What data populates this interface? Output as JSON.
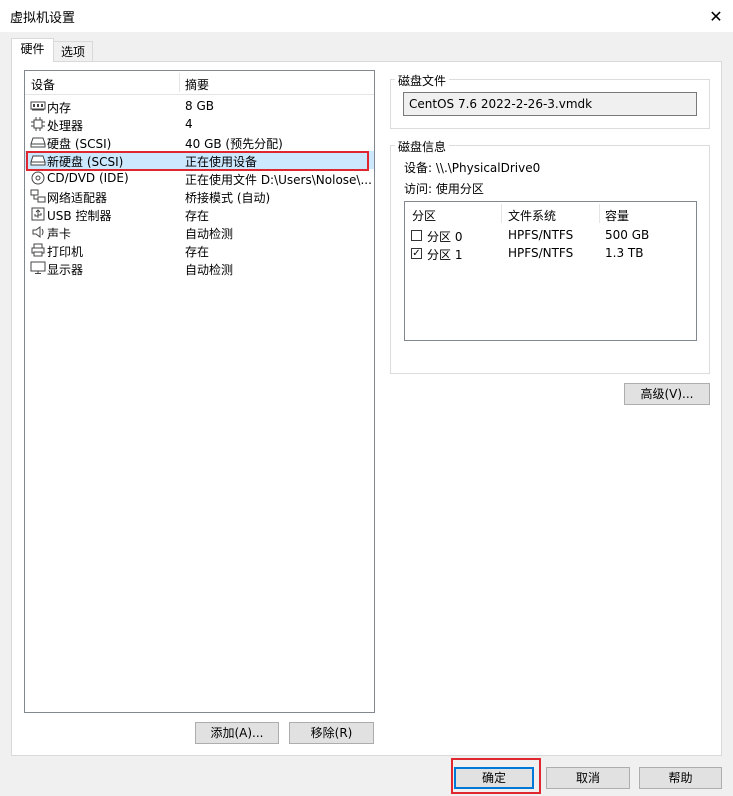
{
  "window": {
    "title": "虚拟机设置",
    "close_glyph": "✕"
  },
  "tabs": [
    {
      "label": "硬件",
      "active": true
    },
    {
      "label": "选项",
      "active": false
    }
  ],
  "device_list": {
    "headers": {
      "device": "设备",
      "summary": "摘要"
    },
    "items": [
      {
        "icon": "memory-icon",
        "name": "内存",
        "summary": "8 GB"
      },
      {
        "icon": "cpu-icon",
        "name": "处理器",
        "summary": "4"
      },
      {
        "icon": "harddisk-icon",
        "name": "硬盘 (SCSI)",
        "summary": "40 GB (预先分配)"
      },
      {
        "icon": "harddisk-icon",
        "name": "新硬盘 (SCSI)",
        "summary": "正在使用设备",
        "selected": true
      },
      {
        "icon": "cd-icon",
        "name": "CD/DVD (IDE)",
        "summary": "正在使用文件 D:\\Users\\Nolose\\..."
      },
      {
        "icon": "network-icon",
        "name": "网络适配器",
        "summary": "桥接模式 (自动)"
      },
      {
        "icon": "usb-icon",
        "name": "USB 控制器",
        "summary": "存在"
      },
      {
        "icon": "sound-icon",
        "name": "声卡",
        "summary": "自动检测"
      },
      {
        "icon": "printer-icon",
        "name": "打印机",
        "summary": "存在"
      },
      {
        "icon": "display-icon",
        "name": "显示器",
        "summary": "自动检测"
      }
    ]
  },
  "buttons": {
    "add": "添加(A)...",
    "remove": "移除(R)",
    "advanced": "高级(V)...",
    "ok": "确定",
    "cancel": "取消",
    "help": "帮助"
  },
  "disk_file": {
    "group_title": "磁盘文件",
    "value": "CentOS 7.6 2022-2-26-3.vmdk"
  },
  "disk_info": {
    "group_title": "磁盘信息",
    "device_line": "设备:  \\\\.\\PhysicalDrive0",
    "access_line": "访问:  使用分区",
    "partitions": {
      "headers": {
        "partition": "分区",
        "filesystem": "文件系统",
        "capacity": "容量"
      },
      "rows": [
        {
          "checked": false,
          "name": "分区 0",
          "filesystem": "HPFS/NTFS",
          "capacity": "500 GB"
        },
        {
          "checked": true,
          "name": "分区 1",
          "filesystem": "HPFS/NTFS",
          "capacity": "1.3 TB"
        }
      ]
    }
  },
  "colors": {
    "highlight_border": "#e0262e",
    "selection": "#cce8ff"
  }
}
